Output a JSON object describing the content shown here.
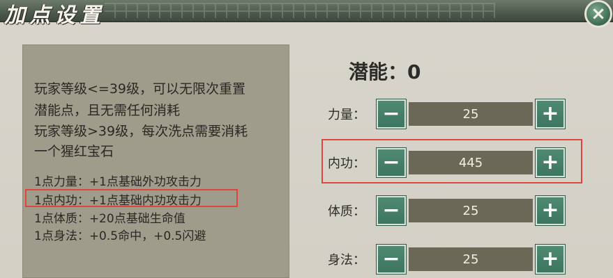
{
  "window": {
    "title": "加点设置",
    "close_label": "×"
  },
  "info": {
    "rules": [
      "玩家等级<=39级，可以无限次重置",
      "潜能点，且无需任何消耗",
      "玩家等级>39级，每次洗点需要消耗",
      "一个猩红宝石"
    ],
    "bonuses": [
      "1点力量：+1点基础外功攻击力",
      "1点内功：+1点基础内功攻击力",
      "1点体质：+20点基础生命值",
      "1点身法：+0.5命中，+0.5闪避"
    ]
  },
  "potential": {
    "label": "潜能：0"
  },
  "stats": [
    {
      "label": "力量：",
      "value": "25",
      "minus": "−",
      "plus": "+"
    },
    {
      "label": "内功：",
      "value": "445",
      "minus": "−",
      "plus": "+"
    },
    {
      "label": "体质：",
      "value": "25",
      "minus": "−",
      "plus": "+"
    },
    {
      "label": "身法：",
      "value": "25",
      "minus": "−",
      "plus": "+"
    }
  ],
  "colors": {
    "highlight": "#e0443c",
    "button": "#4f8a72",
    "value_bg": "#6c6858",
    "panel_bg": "#a09c8b"
  }
}
